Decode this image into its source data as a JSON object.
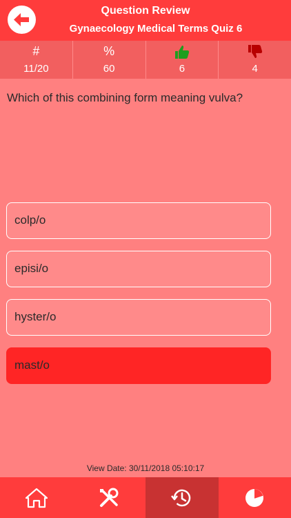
{
  "header": {
    "title": "Question Review",
    "subtitle": "Gynaecology Medical Terms Quiz 6"
  },
  "stats": [
    {
      "symbol": "#",
      "value": "11/20"
    },
    {
      "symbol": "%",
      "value": "60"
    },
    {
      "icon": "thumbs-up-icon",
      "value": "6",
      "color": "#1e9e1e"
    },
    {
      "icon": "thumbs-down-icon",
      "value": "4",
      "color": "#b80000"
    }
  ],
  "question": "Which of this combining form meaning vulva?",
  "options": [
    {
      "label": "colp/o"
    },
    {
      "label": "episi/o"
    },
    {
      "label": "hyster/o"
    },
    {
      "label": "mast/o",
      "selected": true
    }
  ],
  "view_date": "View Date: 30/11/2018 05:10:17",
  "tabs": [
    {
      "icon": "home-icon"
    },
    {
      "icon": "tools-icon"
    },
    {
      "icon": "history-icon",
      "active": true
    },
    {
      "icon": "pie-chart-icon"
    }
  ],
  "colors": {
    "header": "#ff3c3c",
    "background": "#ff8080",
    "stats_bar": "#f25f5f",
    "selected_option": "#ff2525",
    "active_tab": "#c83232"
  }
}
